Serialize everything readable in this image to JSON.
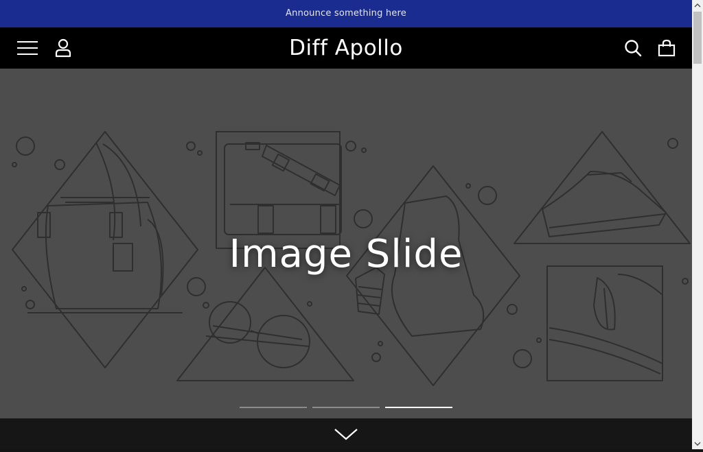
{
  "announcement": {
    "text": "Announce something here",
    "background": "#1a2c8f"
  },
  "header": {
    "title": "Diff Apollo",
    "menu_icon": "hamburger-menu-icon",
    "account_icon": "user-account-icon",
    "search_icon": "search-icon",
    "cart_icon": "shopping-bag-icon"
  },
  "hero": {
    "heading": "Image Slide",
    "background": "#4d4d4d",
    "slide_count": 3,
    "active_slide": 3
  },
  "footer_bar": {
    "scroll_icon": "chevron-down-icon"
  }
}
